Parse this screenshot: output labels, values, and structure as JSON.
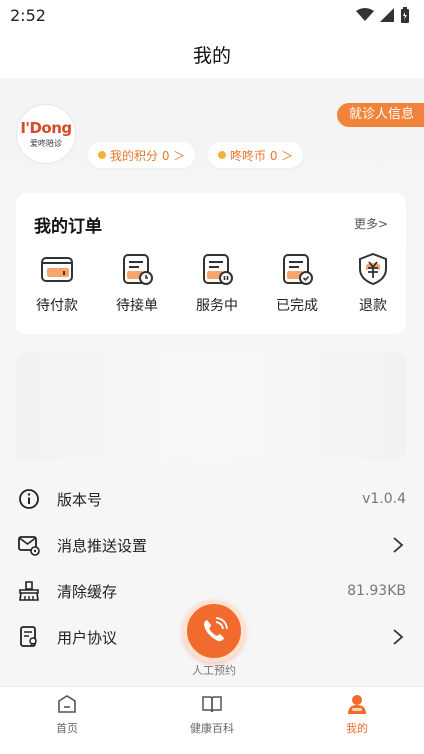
{
  "status_bar": {
    "time": "2:52"
  },
  "header": {
    "title": "我的"
  },
  "profile": {
    "patient_info_label": "就诊人信息",
    "avatar_logo_text": "I'Dong",
    "avatar_sub_text": "爱咚陪诊",
    "points_label": "我的积分 0 ＞",
    "coins_label": "咚咚币 0 ＞"
  },
  "orders": {
    "title": "我的订单",
    "more_label": "更多>",
    "items": [
      {
        "label": "待付款",
        "icon": "wallet-icon"
      },
      {
        "label": "待接单",
        "icon": "pending-order-icon"
      },
      {
        "label": "服务中",
        "icon": "in-service-icon"
      },
      {
        "label": "已完成",
        "icon": "completed-icon"
      },
      {
        "label": "退款",
        "icon": "refund-icon"
      }
    ]
  },
  "menu": {
    "items": [
      {
        "label": "版本号",
        "value": "v1.0.4",
        "icon": "info-icon"
      },
      {
        "label": "消息推送设置",
        "value": "",
        "icon": "message-settings-icon"
      },
      {
        "label": "清除缓存",
        "value": "81.93KB",
        "icon": "broom-icon"
      },
      {
        "label": "用户协议",
        "value": "",
        "icon": "agreement-icon"
      }
    ]
  },
  "call": {
    "label": "人工预约"
  },
  "tabs": [
    {
      "label": "首页",
      "icon": "home-icon"
    },
    {
      "label": "健康百科",
      "icon": "book-icon"
    },
    {
      "label": "我的",
      "icon": "profile-icon"
    }
  ],
  "colors": {
    "accent": "#f06b2d",
    "tag": "#f1843a"
  }
}
